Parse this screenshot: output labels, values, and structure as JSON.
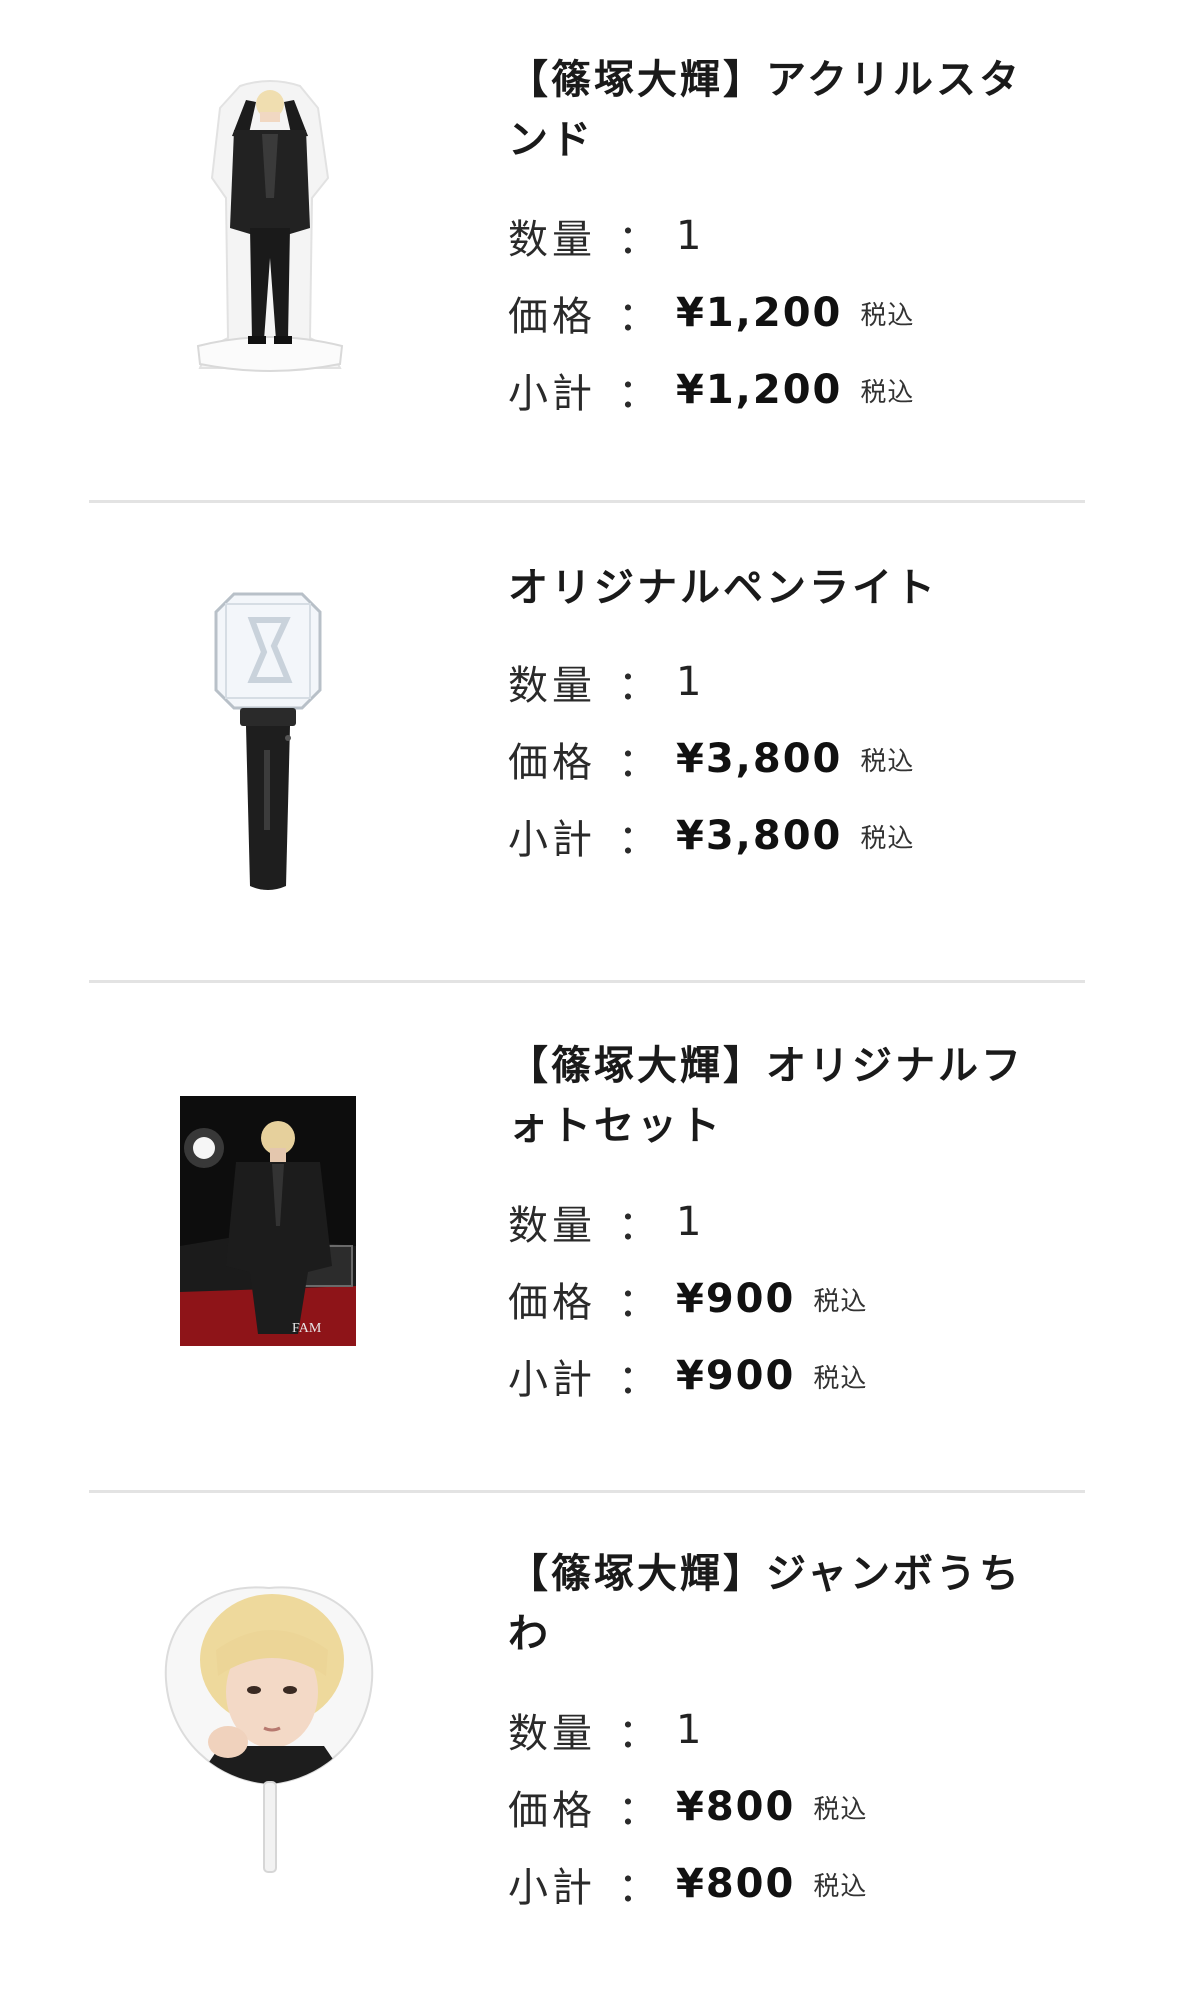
{
  "labels": {
    "quantity": "数量",
    "price": "価格",
    "subtotal": "小計",
    "colon": "：",
    "tax_included": "税込"
  },
  "items": [
    {
      "title": "【篠塚大輝】アクリルスタンド",
      "title_lines": [
        "【篠塚大輝】アクリルスタ",
        "ンド"
      ],
      "image": "acrylic-stand-image",
      "quantity": "1",
      "price": "¥1,200",
      "subtotal": "¥1,200"
    },
    {
      "title": "オリジナルペンライト",
      "title_lines": [
        "オリジナルペンライト"
      ],
      "image": "penlight-image",
      "quantity": "1",
      "price": "¥3,800",
      "subtotal": "¥3,800"
    },
    {
      "title": "【篠塚大輝】オリジナルフォトセット",
      "title_lines": [
        "【篠塚大輝】オリジナルフ",
        "ォトセット"
      ],
      "image": "photo-set-image",
      "photo_caption": "FAM",
      "quantity": "1",
      "price": "¥900",
      "subtotal": "¥900"
    },
    {
      "title": "【篠塚大輝】ジャンボうちわ",
      "title_lines": [
        "【篠塚大輝】ジャンボうち",
        "わ"
      ],
      "image": "jumbo-uchiwa-image",
      "quantity": "1",
      "price": "¥800",
      "subtotal": "¥800"
    }
  ],
  "colors": {
    "divider": "#e3e3e3",
    "text": "#1a1a1a"
  }
}
